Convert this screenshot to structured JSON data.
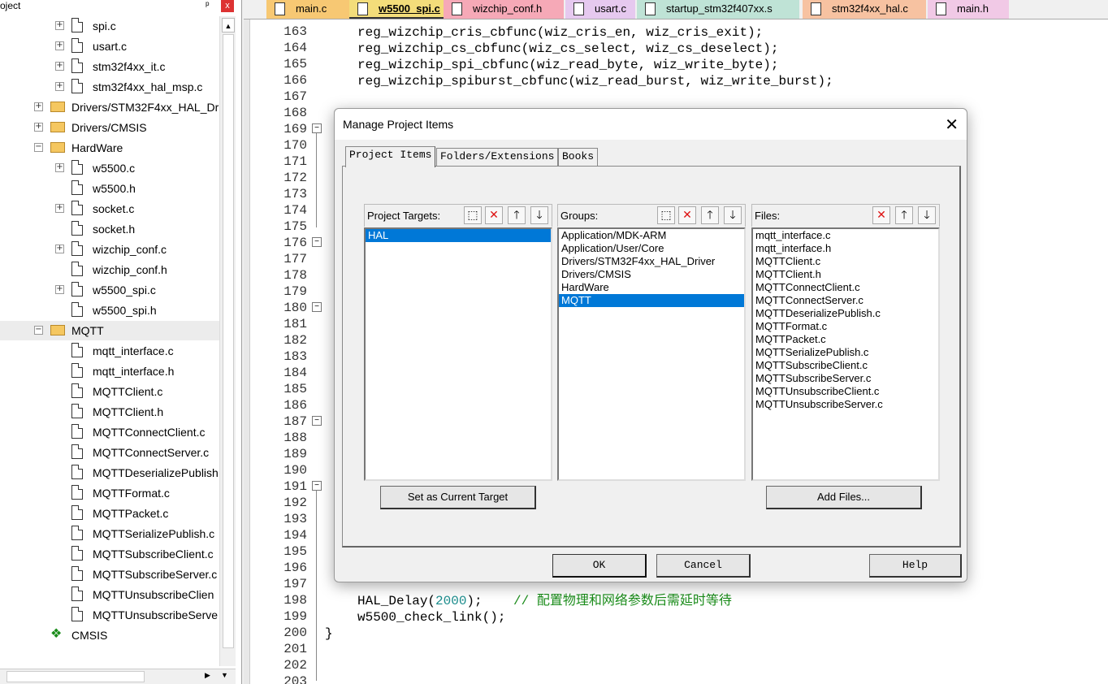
{
  "project": {
    "title": "oject",
    "pin": "ф",
    "close": "x",
    "tree": [
      {
        "label": "spi.c",
        "depth": 2,
        "kind": "file",
        "toggle": "+"
      },
      {
        "label": "usart.c",
        "depth": 2,
        "kind": "file",
        "toggle": "+"
      },
      {
        "label": "stm32f4xx_it.c",
        "depth": 2,
        "kind": "file",
        "toggle": "+"
      },
      {
        "label": "stm32f4xx_hal_msp.c",
        "depth": 2,
        "kind": "file",
        "toggle": "+"
      },
      {
        "label": "Drivers/STM32F4xx_HAL_Dr",
        "depth": 1,
        "kind": "folder",
        "toggle": "+"
      },
      {
        "label": "Drivers/CMSIS",
        "depth": 1,
        "kind": "folder",
        "toggle": "+"
      },
      {
        "label": "HardWare",
        "depth": 1,
        "kind": "folder-open",
        "toggle": "-"
      },
      {
        "label": "w5500.c",
        "depth": 2,
        "kind": "file",
        "toggle": "+"
      },
      {
        "label": "w5500.h",
        "depth": 2,
        "kind": "file",
        "toggle": ""
      },
      {
        "label": "socket.c",
        "depth": 2,
        "kind": "file",
        "toggle": "+"
      },
      {
        "label": "socket.h",
        "depth": 2,
        "kind": "file",
        "toggle": ""
      },
      {
        "label": "wizchip_conf.c",
        "depth": 2,
        "kind": "file",
        "toggle": "+"
      },
      {
        "label": "wizchip_conf.h",
        "depth": 2,
        "kind": "file",
        "toggle": ""
      },
      {
        "label": "w5500_spi.c",
        "depth": 2,
        "kind": "file",
        "toggle": "+"
      },
      {
        "label": "w5500_spi.h",
        "depth": 2,
        "kind": "file",
        "toggle": ""
      },
      {
        "label": "MQTT",
        "depth": 1,
        "kind": "folder-open",
        "toggle": "-",
        "selected": true
      },
      {
        "label": "mqtt_interface.c",
        "depth": 2,
        "kind": "file",
        "toggle": ""
      },
      {
        "label": "mqtt_interface.h",
        "depth": 2,
        "kind": "file",
        "toggle": ""
      },
      {
        "label": "MQTTClient.c",
        "depth": 2,
        "kind": "file",
        "toggle": ""
      },
      {
        "label": "MQTTClient.h",
        "depth": 2,
        "kind": "file",
        "toggle": ""
      },
      {
        "label": "MQTTConnectClient.c",
        "depth": 2,
        "kind": "file",
        "toggle": ""
      },
      {
        "label": "MQTTConnectServer.c",
        "depth": 2,
        "kind": "file",
        "toggle": ""
      },
      {
        "label": "MQTTDeserializePublish",
        "depth": 2,
        "kind": "file",
        "toggle": ""
      },
      {
        "label": "MQTTFormat.c",
        "depth": 2,
        "kind": "file",
        "toggle": ""
      },
      {
        "label": "MQTTPacket.c",
        "depth": 2,
        "kind": "file",
        "toggle": ""
      },
      {
        "label": "MQTTSerializePublish.c",
        "depth": 2,
        "kind": "file",
        "toggle": ""
      },
      {
        "label": "MQTTSubscribeClient.c",
        "depth": 2,
        "kind": "file",
        "toggle": ""
      },
      {
        "label": "MQTTSubscribeServer.c",
        "depth": 2,
        "kind": "file",
        "toggle": ""
      },
      {
        "label": "MQTTUnsubscribeClien",
        "depth": 2,
        "kind": "file",
        "toggle": ""
      },
      {
        "label": "MQTTUnsubscribeServe",
        "depth": 2,
        "kind": "file",
        "toggle": ""
      },
      {
        "label": "CMSIS",
        "depth": 1,
        "kind": "gem",
        "toggle": ""
      }
    ]
  },
  "tabs": [
    {
      "label": "main.c",
      "color": "#f7c873",
      "active": false
    },
    {
      "label": "w5500_spi.c",
      "color": "#f3dd7a",
      "active": true
    },
    {
      "label": "wizchip_conf.h",
      "color": "#f6a9b7",
      "active": false
    },
    {
      "label": "usart.c",
      "color": "#e6c9ef",
      "active": false
    },
    {
      "label": "startup_stm32f407xx.s",
      "color": "#bfe3d6",
      "active": false
    },
    {
      "label": "stm32f4xx_hal.c",
      "color": "#f7c2a1",
      "active": false
    },
    {
      "label": "main.h",
      "color": "#f1c9e6",
      "active": false
    }
  ],
  "editor": {
    "line_numbers": [
      "163",
      "164",
      "165",
      "166",
      "167",
      "168",
      "169",
      "170",
      "171",
      "172",
      "173",
      "174",
      "175",
      "176",
      "177",
      "178",
      "179",
      "180",
      "181",
      "182",
      "183",
      "184",
      "185",
      "186",
      "187",
      "188",
      "189",
      "190",
      "191",
      "192",
      "193",
      "194",
      "195",
      "196",
      "197",
      "198",
      "199",
      "200",
      "201",
      "202",
      "203"
    ],
    "code": {
      "l163": "reg_wizchip_cris_cbfunc(wiz_cris_en, wiz_cris_exit);",
      "l164": "reg_wizchip_cs_cbfunc(wiz_cs_select, wiz_cs_deselect);",
      "l165": "reg_wizchip_spi_cbfunc(wiz_read_byte, wiz_write_byte);",
      "l166": "reg_wizchip_spiburst_cbfunc(wiz_read_burst, wiz_write_burst);",
      "l198_call": "HAL_Delay(",
      "l198_num": "2000",
      "l198_end": ");",
      "l198_cmt": "// 配置物理和网络参数后需延时等待",
      "l199": "w5500_check_link();",
      "l200": "}"
    }
  },
  "dialog": {
    "title": "Manage Project Items",
    "close": "✕",
    "tabs": [
      "Project Items",
      "Folders/Extensions",
      "Books"
    ],
    "targets": {
      "label": "Project Targets:",
      "items": [
        "HAL"
      ],
      "selected": "HAL"
    },
    "groups": {
      "label": "Groups:",
      "items": [
        "Application/MDK-ARM",
        "Application/User/Core",
        "Drivers/STM32F4xx_HAL_Driver",
        "Drivers/CMSIS",
        "HardWare",
        "MQTT"
      ],
      "selected": "MQTT"
    },
    "files": {
      "label": "Files:",
      "items": [
        "mqtt_interface.c",
        "mqtt_interface.h",
        "MQTTClient.c",
        "MQTTClient.h",
        "MQTTConnectClient.c",
        "MQTTConnectServer.c",
        "MQTTDeserializePublish.c",
        "MQTTFormat.c",
        "MQTTPacket.c",
        "MQTTSerializePublish.c",
        "MQTTSubscribeClient.c",
        "MQTTSubscribeServer.c",
        "MQTTUnsubscribeClient.c",
        "MQTTUnsubscribeServer.c"
      ]
    },
    "set_target_button": "Set as Current Target",
    "add_files_button": "Add Files...",
    "ok_button": "OK",
    "cancel_button": "Cancel",
    "help_button": "Help"
  }
}
